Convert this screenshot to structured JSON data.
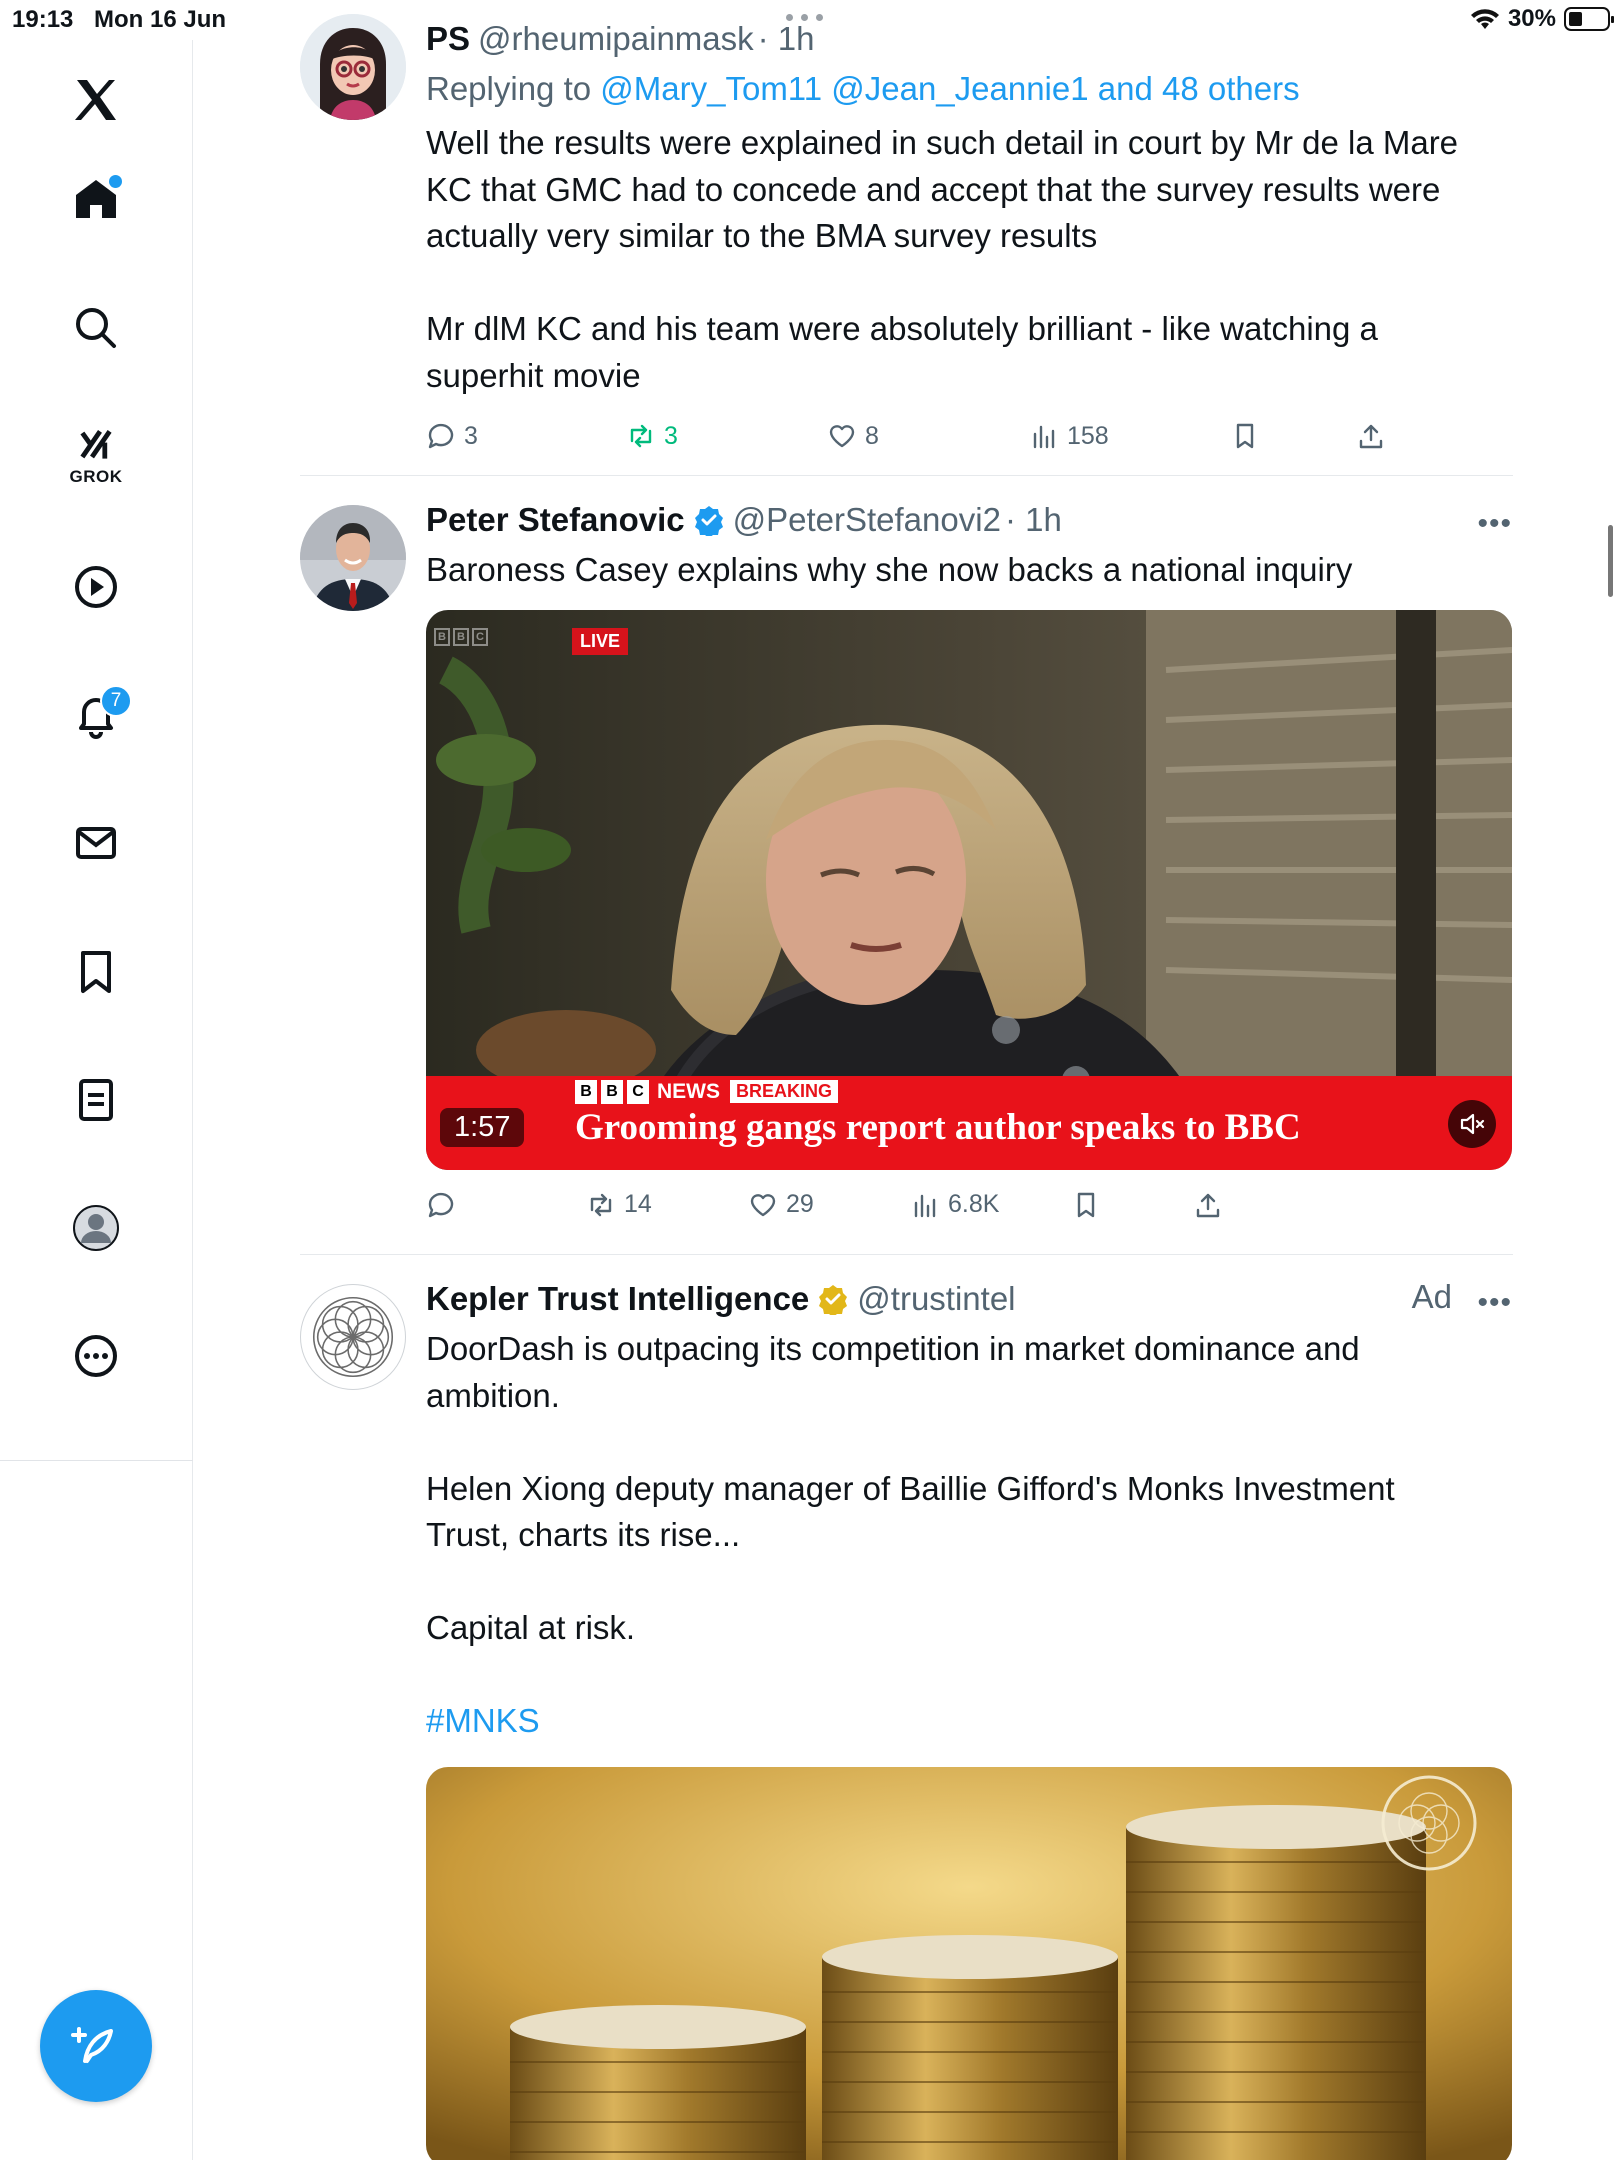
{
  "status_bar": {
    "time": "19:13",
    "date": "Mon 16 Jun",
    "battery": "30%"
  },
  "sidebar": {
    "notifications_badge": "7",
    "grok_label": "GROK"
  },
  "tweets": [
    {
      "display_name": "PS",
      "handle": "@rheumipainmask",
      "time": "· 1h",
      "replying_prefix": "Replying to",
      "replying_links": "@Mary_Tom11 @Jean_Jeannie1 and 48 others",
      "text": [
        "Well the results were explained in such detail in court by Mr de la Mare",
        "KC that GMC had to concede and accept that the survey results were",
        "actually very similar to the BMA survey results",
        "",
        "Mr dlM KC and his team were absolutely brilliant - like watching a",
        "superhit movie"
      ],
      "stats": {
        "replies": "3",
        "retweets": "3",
        "likes": "8",
        "views": "158"
      }
    },
    {
      "display_name": "Peter Stefanovic",
      "handle": "@PeterStefanovi2",
      "time": "· 1h",
      "verified": "blue",
      "text": [
        "Baroness Casey explains why she now backs a national inquiry"
      ],
      "video": {
        "live_badge": "LIVE",
        "duration": "1:57",
        "bbc_letters": [
          "B",
          "B",
          "C"
        ],
        "news_word": "NEWS",
        "breaking": "BREAKING",
        "headline": "Grooming gangs report author speaks to BBC"
      },
      "stats": {
        "retweets": "14",
        "likes": "29",
        "views": "6.8K"
      }
    },
    {
      "display_name": "Kepler Trust Intelligence",
      "handle": "@trustintel",
      "verified": "gold",
      "ad_label": "Ad",
      "text": [
        "DoorDash is outpacing its competition in market dominance and",
        "ambition.",
        "",
        "Helen Xiong deputy manager of Baillie Gifford's Monks Investment",
        "Trust, charts its rise...",
        "",
        "Capital at risk.",
        ""
      ],
      "hashtag": "#MNKS"
    }
  ],
  "colors": {
    "accent": "#1d9bf0",
    "retweet_green": "#00ba7c",
    "bbc_red": "#e8121a",
    "gold_badge": "#e2b719"
  }
}
